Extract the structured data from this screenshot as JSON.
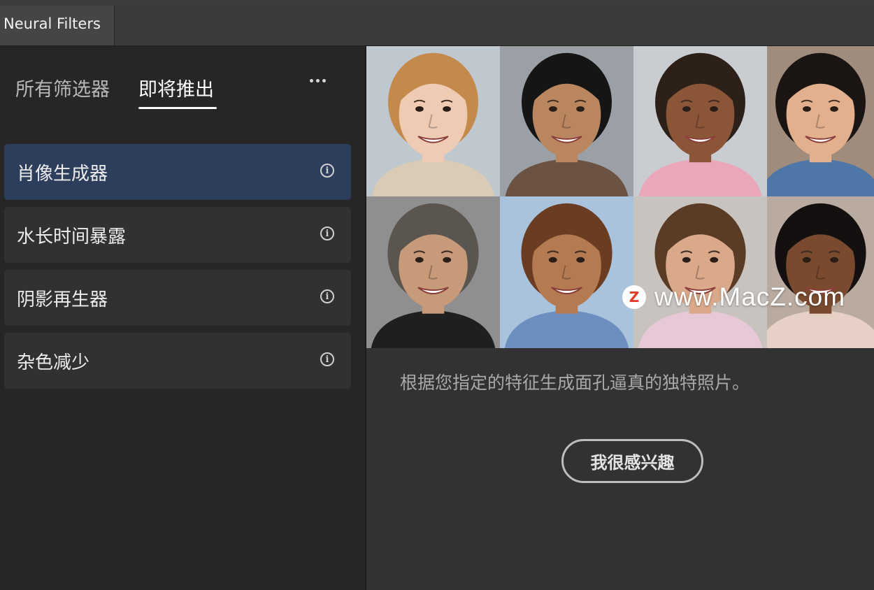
{
  "window": {
    "tab_title": "Neural Filters"
  },
  "sidebar": {
    "segment_tabs": [
      {
        "label": "所有筛选器",
        "active": false
      },
      {
        "label": "即将推出",
        "active": true
      }
    ],
    "more_icon": "more-horizontal-icon",
    "filters": [
      {
        "label": "肖像生成器",
        "selected": true,
        "icon": "info-icon"
      },
      {
        "label": "水长时间暴露",
        "selected": false,
        "icon": "info-icon"
      },
      {
        "label": "阴影再生器",
        "selected": false,
        "icon": "info-icon"
      },
      {
        "label": "杂色减少",
        "selected": false,
        "icon": "info-icon"
      }
    ]
  },
  "preview": {
    "watermark": {
      "logo_letter": "Z",
      "text": "www.MacZ.com"
    },
    "portraits": [
      {
        "bg": "#bfc7cf",
        "skin": "#efcbb4",
        "hair": "#c48a4c",
        "shirt": "#d9cbb6"
      },
      {
        "bg": "#9aa0a6",
        "skin": "#b98660",
        "hair": "#151515",
        "shirt": "#6b5242"
      },
      {
        "bg": "#c9ccd1",
        "skin": "#8b5538",
        "hair": "#2d2018",
        "shirt": "#e9a7b9"
      },
      {
        "bg": "#9f8c7c",
        "skin": "#e2b08d",
        "hair": "#1a1412",
        "shirt": "#4e77a8"
      },
      {
        "bg": "#8f8f8f",
        "skin": "#c79a79",
        "hair": "#5b5550",
        "shirt": "#1f1f1f"
      },
      {
        "bg": "#a9c3dd",
        "skin": "#b47a52",
        "hair": "#6a3d22",
        "shirt": "#6d8fbf"
      },
      {
        "bg": "#c8c3be",
        "skin": "#d9a98a",
        "hair": "#5a3b25",
        "shirt": "#e7c8d6"
      },
      {
        "bg": "#b9aba0",
        "skin": "#7a4a2e",
        "hair": "#151010",
        "shirt": "#e7d0c6"
      }
    ]
  },
  "description": "根据您指定的特征生成面孔逼真的独特照片。",
  "cta": {
    "label": "我很感兴趣"
  }
}
